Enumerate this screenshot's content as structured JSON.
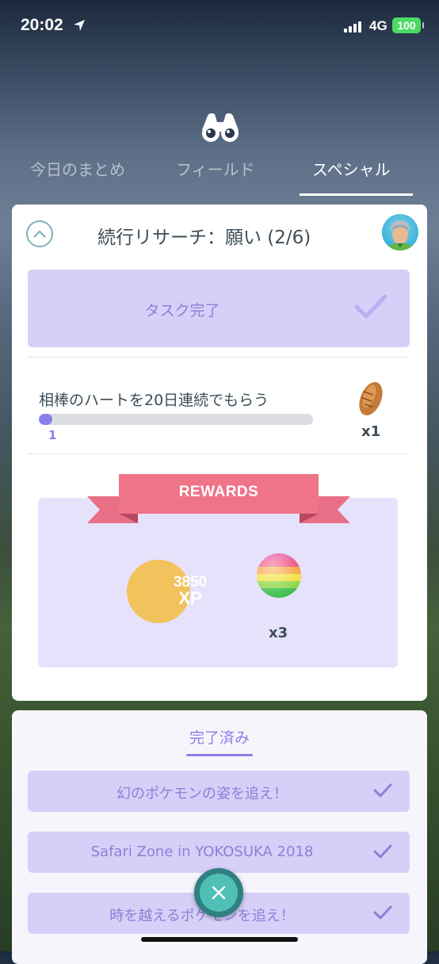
{
  "status_bar": {
    "time": "20:02",
    "network": "4G",
    "battery": "100"
  },
  "tabs": [
    {
      "label": "今日のまとめ",
      "active": false
    },
    {
      "label": "フィールド",
      "active": false
    },
    {
      "label": "スペシャル",
      "active": true
    }
  ],
  "research": {
    "title": "続行リサーチ：願い (2/6)",
    "task_done_label": "タスク完了",
    "task": {
      "text": "相棒のハートを20日連続でもらう",
      "progress_value": "1",
      "progress_fraction": 0.05,
      "reward_icon": "bread-icon",
      "reward_count": "x1"
    },
    "rewards_label": "REWARDS",
    "rewards": {
      "xp_amount": "3850",
      "xp_unit": "XP",
      "item_icon": "rainbow-berry-icon",
      "item_count": "x3"
    }
  },
  "completed": {
    "tab_label": "完了済み",
    "items": [
      {
        "label": "幻のポケモンの姿を追え！"
      },
      {
        "label": "Safari Zone in YOKOSUKA 2018"
      },
      {
        "label": "時を越えるポケモンを追え！"
      }
    ]
  },
  "colors": {
    "accent": "#8a7eea",
    "task_done_bg": "#d7cff8",
    "rewards_ribbon": "#e86f85",
    "xp_coin": "#f2c35c",
    "close_button": "#4fc0b5"
  }
}
